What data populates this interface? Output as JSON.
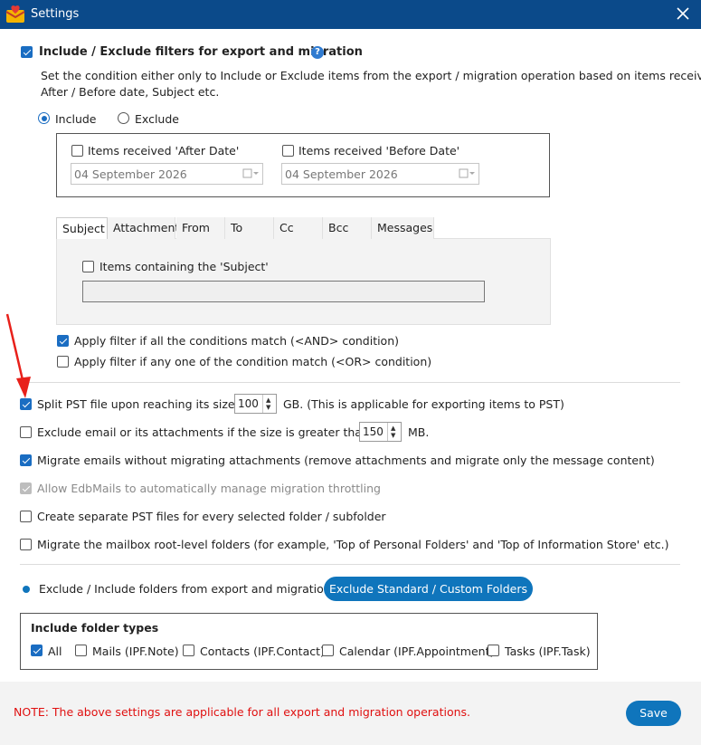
{
  "window": {
    "title": "Settings"
  },
  "filters": {
    "label": "Include / Exclude filters for export and migration",
    "checked": true,
    "description_line1": "Set the condition either only to Include or Exclude items from the export / migration operation based on items received",
    "description_line2": "After / Before date, Subject etc.",
    "mode_include": "Include",
    "mode_exclude": "Exclude",
    "after_date": {
      "label": "Items received 'After Date'",
      "checked": false,
      "value": "04 September 2026"
    },
    "before_date": {
      "label": "Items received 'Before Date'",
      "checked": false,
      "value": "04 September 2026"
    },
    "tabs": [
      "Subject",
      "Attachment",
      "From",
      "To",
      "Cc",
      "Bcc",
      "Messages"
    ],
    "active_tab": "Subject",
    "subject_label": "Items containing the 'Subject'",
    "subject_value": "",
    "and_condition": {
      "label": "Apply filter if all the conditions match (<AND> condition)",
      "checked": true
    },
    "or_condition": {
      "label": "Apply filter if any one of the condition match (<OR> condition)",
      "checked": false
    }
  },
  "options": {
    "split_pst": {
      "label_before": "Split PST file upon reaching its size",
      "value": "100",
      "label_after": "GB. (This is applicable for exporting items to PST)",
      "checked": true
    },
    "exclude_size": {
      "label_before": "Exclude email or its attachments if the size is greater than",
      "value": "150",
      "label_after": "MB.",
      "checked": false
    },
    "no_attachments": {
      "label": "Migrate emails without migrating attachments (remove attachments and migrate only the message content)",
      "checked": true
    },
    "throttling": {
      "label": "Allow EdbMails to automatically manage migration throttling",
      "checked": true,
      "disabled": true
    },
    "separate_pst": {
      "label": "Create separate PST files for every selected folder / subfolder",
      "checked": false
    },
    "root_level": {
      "label": "Migrate the mailbox root-level folders (for example, 'Top of Personal Folders' and 'Top of Information Store' etc.)",
      "checked": false
    }
  },
  "folders": {
    "label": "Exclude / Include folders from export and migration",
    "button": "Exclude Standard / Custom Folders",
    "types_title": "Include folder types",
    "types": [
      {
        "label": "All",
        "checked": true
      },
      {
        "label": "Mails (IPF.Note)",
        "checked": false
      },
      {
        "label": "Contacts (IPF.Contact)",
        "checked": false
      },
      {
        "label": "Calendar (IPF.Appointment)",
        "checked": false
      },
      {
        "label": "Tasks (IPF.Task)",
        "checked": false
      }
    ]
  },
  "footer": {
    "note": "NOTE: The above settings are applicable for all export and migration operations.",
    "save": "Save"
  },
  "colors": {
    "titlebar": "#0b4a8a",
    "accent": "#1a6dc2",
    "button": "#0f75bc",
    "note": "#e01010",
    "annotation_arrow": "#e8201a"
  }
}
